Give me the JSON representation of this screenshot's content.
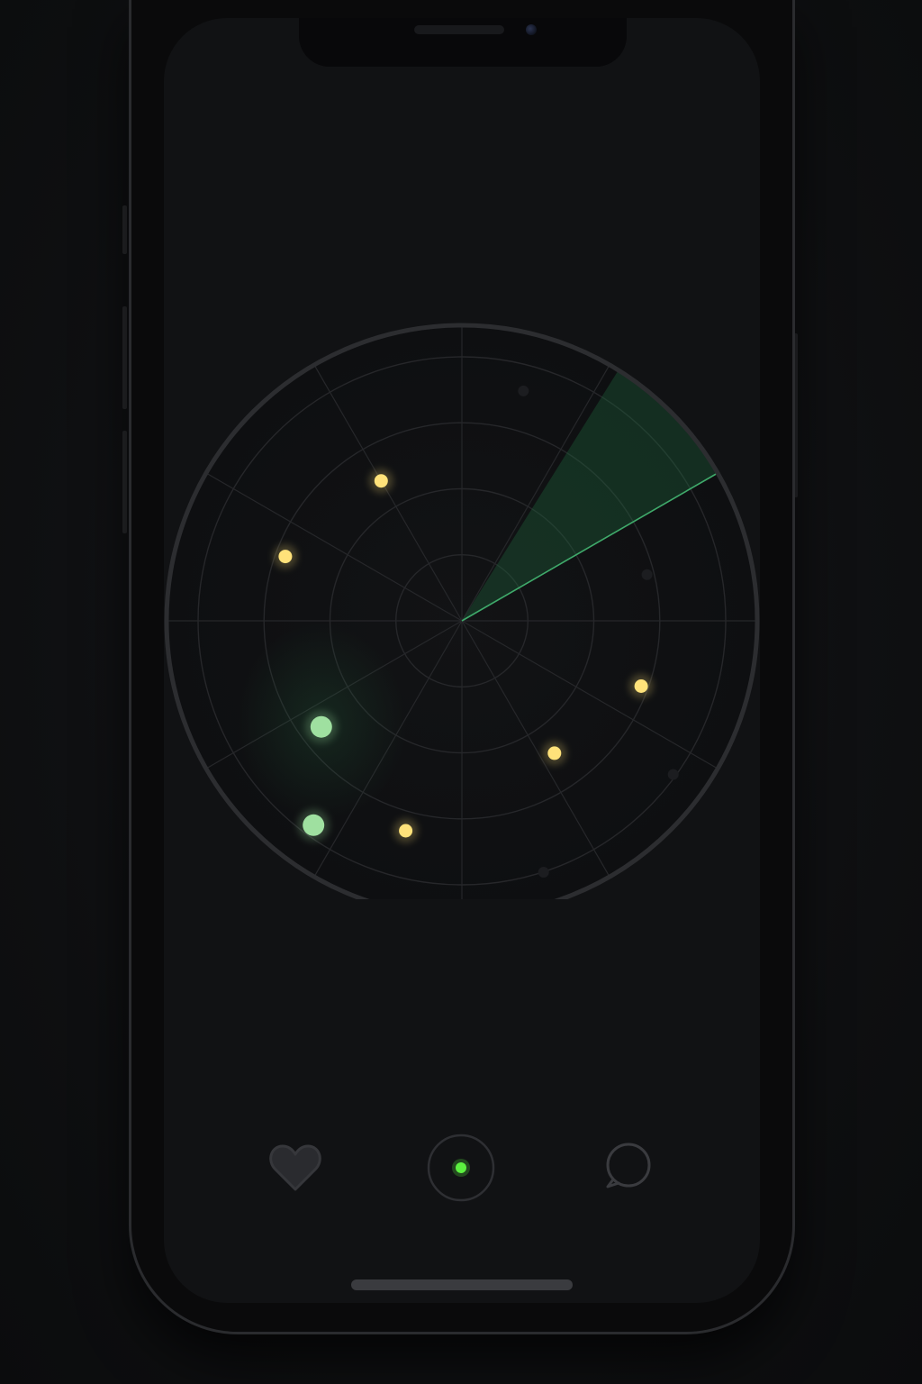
{
  "app": {
    "screen": "radar"
  },
  "colors": {
    "background": "#111214",
    "ring": "#2c2d30",
    "grid": "#26272a",
    "sweep": "#3fa96a",
    "blip_active": "#9fe0a0",
    "blip_target": "#ffe27a",
    "blip_faint": "#1c1d20",
    "nav_icon": "#3a3b3f",
    "center_dot": "#5cf040"
  },
  "radar": {
    "rings": 4,
    "spokes": 12,
    "sweep_angle_deg": 60,
    "sweep_width_deg": 28,
    "blips": [
      {
        "type": "target",
        "angle_deg": 330,
        "distance": 0.55
      },
      {
        "type": "target",
        "angle_deg": 290,
        "distance": 0.64
      },
      {
        "type": "target",
        "angle_deg": 110,
        "distance": 0.65
      },
      {
        "type": "target",
        "angle_deg": 145,
        "distance": 0.55
      },
      {
        "type": "target",
        "angle_deg": 195,
        "distance": 0.74
      },
      {
        "type": "active",
        "angle_deg": 233,
        "distance": 0.6
      },
      {
        "type": "active",
        "angle_deg": 216,
        "distance": 0.86
      },
      {
        "type": "faint",
        "angle_deg": 15,
        "distance": 0.81
      },
      {
        "type": "faint",
        "angle_deg": 76,
        "distance": 0.65
      },
      {
        "type": "faint",
        "angle_deg": 126,
        "distance": 0.89
      },
      {
        "type": "faint",
        "angle_deg": 162,
        "distance": 0.9
      }
    ]
  },
  "nav": {
    "items": [
      {
        "name": "favorites",
        "icon": "heart-icon"
      },
      {
        "name": "scan",
        "icon": "radar-dot-icon"
      },
      {
        "name": "messages",
        "icon": "chat-bubble-icon"
      }
    ]
  }
}
